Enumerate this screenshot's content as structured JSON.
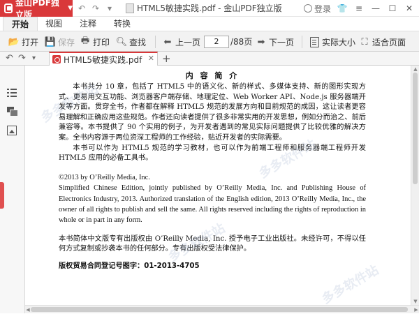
{
  "app": {
    "name": "金山PDF独立版",
    "window_title": "HTML5敏捷实践.pdf - 金山PDF独立版",
    "login_label": "登录"
  },
  "menu": {
    "tabs": [
      "开始",
      "视图",
      "注释",
      "转换"
    ],
    "active": "开始"
  },
  "toolbar": {
    "open": "打开",
    "save": "保存",
    "print": "打印",
    "find": "查找",
    "prev": "上一页",
    "page_current": "2",
    "page_total": "/88页",
    "next": "下一页",
    "actual_size": "实际大小",
    "fit_page": "适合页面"
  },
  "doc_tab": {
    "filename": "HTML5敏捷实践.pdf"
  },
  "document": {
    "heading": "内 容 简 介",
    "para1": "本书共分 10 章，包括了 HTML5 中的语义化、新的样式、多媒体支持、新的图形实现方式、更易用交互功能、浏览器客户端存储、地理定位、Web Worker API、Node.js 服务器端开发等方面。贯穿全书，作者都在解释 HTML5 规范的发展方向和目前规范的成因，这让读者更容易理解和正确应用这些规范。作者还向读者提供了很多非常实用的开发思想，例如分而治之、前后兼容等。本书提供了 90 个实用的例子，为开发者遇到的常见实际问题提供了比较优雅的解决方案。全书内容源于两位资深工程师的工作经验，贴近开发者的实际需要。",
    "para2": "本书可以作为 HTML5 规范的学习教材，也可以作为前端工程师和服务器端工程师开发 HTML5 应用的必备工具书。",
    "copyright_line": "©2013 by O’Reilly Media, Inc.",
    "en_para": "Simplified Chinese Edition, jointly published by O’Reilly Media, Inc. and Publishing House of Electronics Industry, 2013. Authorized translation of the English edition, 2013 O’Reilly Media, Inc., the owner of all rights to publish and sell the same. All rights reserved including the rights of reproduction in whole or in part in any form.",
    "cn_rights": "本书简体中文版专有出版权由 O’Reilly Media, Inc. 授予电子工业出版社。未经许可，不得以任何方式复制或抄袭本书的任何部分。专有出版权受法律保护。",
    "registration": "版权贸易合同登记号图字：01-2013-4705"
  },
  "watermark": "多多软件站",
  "colors": {
    "brand_red": "#d9383a",
    "toolbar_bg": "#f2f2f2"
  }
}
